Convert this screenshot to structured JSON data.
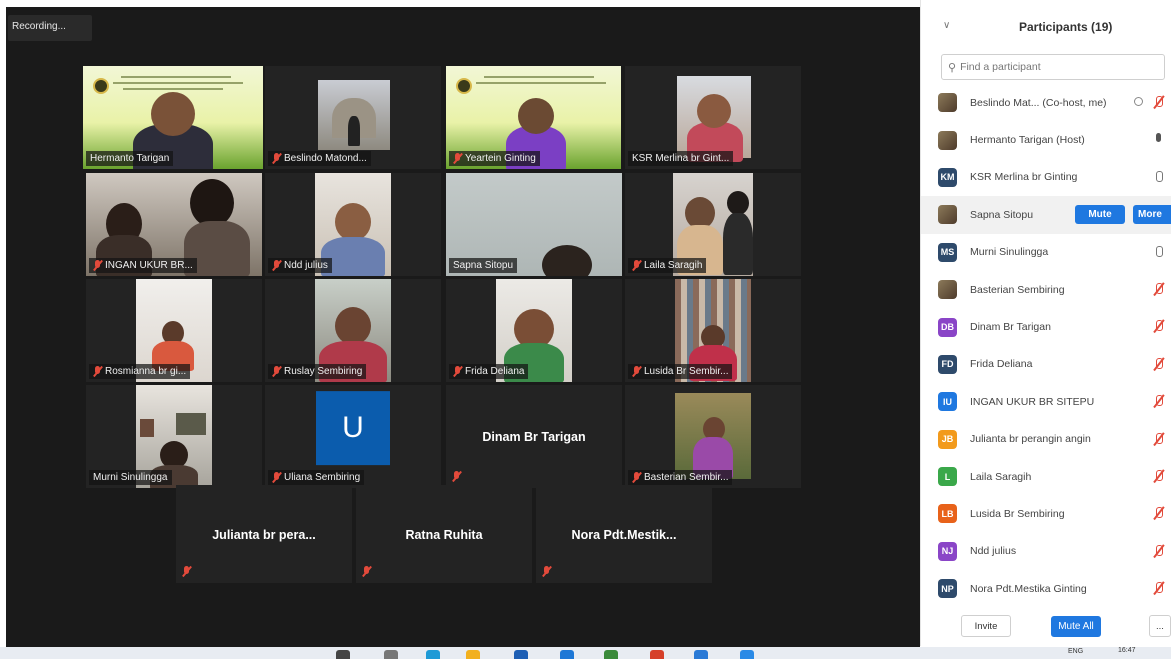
{
  "meeting": {
    "recording_label": "Recording..."
  },
  "tiles": [
    {
      "name": "Hermanto Tarigan",
      "muted": false
    },
    {
      "name": "Beslindo Matond...",
      "muted": true
    },
    {
      "name": "Yeartein Ginting",
      "muted": true
    },
    {
      "name": "KSR Merlina br Gint...",
      "muted": false
    },
    {
      "name": "INGAN UKUR BR...",
      "muted": true
    },
    {
      "name": "Ndd julius",
      "muted": true
    },
    {
      "name": "Sapna Sitopu",
      "muted": false
    },
    {
      "name": "Laila Saragih",
      "muted": true
    },
    {
      "name": "Rosmianna br gi...",
      "muted": true
    },
    {
      "name": "Ruslay Sembiring",
      "muted": true
    },
    {
      "name": "Frida Deliana",
      "muted": true
    },
    {
      "name": "Lusida Br Sembir...",
      "muted": true
    },
    {
      "name": "Murni Sinulingga",
      "muted": false
    },
    {
      "name": "Uliana Sembiring",
      "muted": true,
      "avatar_letter": "U"
    },
    {
      "name": "Dinam Br Tarigan",
      "muted": true,
      "no_video": true
    },
    {
      "name": "Basterian Sembir...",
      "muted": true
    },
    {
      "name": "Julianta br pera...",
      "muted": true,
      "no_video": true
    },
    {
      "name": "Ratna Ruhita",
      "muted": true,
      "no_video": true
    },
    {
      "name": "Nora Pdt.Mestik...",
      "muted": true,
      "no_video": true
    }
  ],
  "panel": {
    "title": "Participants (19)",
    "search_placeholder": "Find a participant",
    "mute_label": "Mute",
    "more_label": "More",
    "invite_label": "Invite",
    "mute_all_label": "Mute All",
    "more_dots": "...",
    "participants": [
      {
        "name": "Beslindo Mat... (Co-host, me)",
        "initials": "",
        "color": "#6b5a44",
        "mic": "muted",
        "video_icon": true
      },
      {
        "name": "Hermanto Tarigan (Host)",
        "initials": "",
        "color": "#3c6e9e",
        "mic": "active"
      },
      {
        "name": "KSR Merlina br Ginting",
        "initials": "KM",
        "color": "#2e4a6b",
        "mic": "open"
      },
      {
        "name": "Sapna Sitopu",
        "initials": "",
        "color": "#7a6a50",
        "mic": "none",
        "highlight": true
      },
      {
        "name": "Murni Sinulingga",
        "initials": "MS",
        "color": "#2e4a6b",
        "mic": "open"
      },
      {
        "name": "Basterian Sembiring",
        "initials": "",
        "color": "#8a7a3a",
        "mic": "muted"
      },
      {
        "name": "Dinam Br Tarigan",
        "initials": "DB",
        "color": "#8a45c7",
        "mic": "muted"
      },
      {
        "name": "Frida Deliana",
        "initials": "FD",
        "color": "#2e4a6b",
        "mic": "muted"
      },
      {
        "name": "INGAN UKUR BR SITEPU",
        "initials": "IU",
        "color": "#1f78e0",
        "mic": "muted"
      },
      {
        "name": "Julianta br perangin angin",
        "initials": "JB",
        "color": "#f29a1c",
        "mic": "muted"
      },
      {
        "name": "Laila Saragih",
        "initials": "L",
        "color": "#3aa84a",
        "mic": "muted"
      },
      {
        "name": "Lusida Br Sembiring",
        "initials": "LB",
        "color": "#e8621a",
        "mic": "muted"
      },
      {
        "name": "Ndd julius",
        "initials": "NJ",
        "color": "#8a45c7",
        "mic": "muted"
      },
      {
        "name": "Nora Pdt.Mestika Ginting",
        "initials": "NP",
        "color": "#2e4a6b",
        "mic": "muted"
      }
    ]
  },
  "taskbar": {
    "lang": "ENG",
    "time": "16:47"
  }
}
